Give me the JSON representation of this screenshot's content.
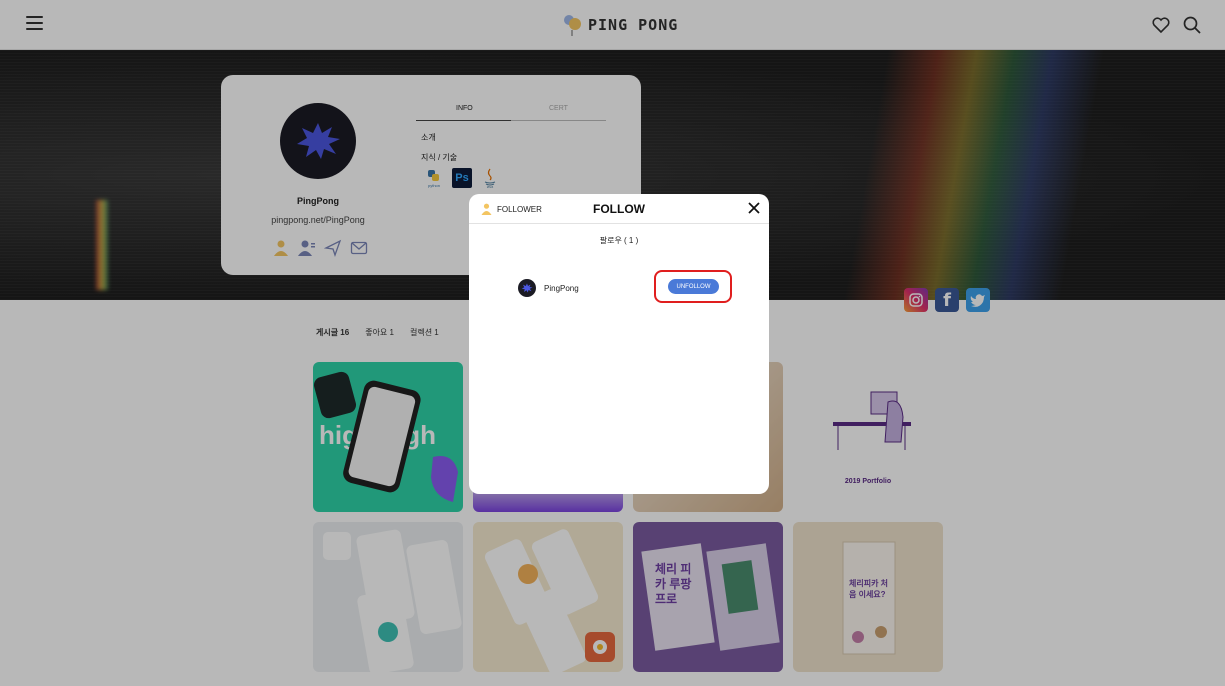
{
  "header": {
    "logo_text": "PING PONG"
  },
  "profile": {
    "name": "PingPong",
    "url": "pingpong.net/PingPong",
    "tabs": [
      {
        "label": "INFO",
        "active": true
      },
      {
        "label": "CERT",
        "active": false
      }
    ],
    "intro_label": "소개",
    "skills_label": "지식 / 기술",
    "skills": [
      {
        "name": "python",
        "icon": "python-icon"
      },
      {
        "name": "Ps",
        "icon": "photoshop-icon"
      },
      {
        "name": "java",
        "icon": "java-icon"
      }
    ]
  },
  "stats": {
    "posts": "게시글 16",
    "likes": "좋아요 1",
    "collections": "컬렉션 1"
  },
  "tiles": {
    "portfolio_caption": "2019 Portfolio",
    "highhigh": "high high",
    "korean_book": "체리 피카 루팡 프로",
    "korean_flyer": "체리피카 처음 이세요?"
  },
  "modal": {
    "follower_tab": "FOLLOWER",
    "title": "FOLLOW",
    "count": "팔로우 ( 1 )",
    "followers": [
      {
        "name": "PingPong",
        "button": "UNFOLLOW"
      }
    ]
  },
  "colors": {
    "accent": "#4a7ad8",
    "highlight": "#e01e1e",
    "avatar_star": "#4b57e0"
  }
}
